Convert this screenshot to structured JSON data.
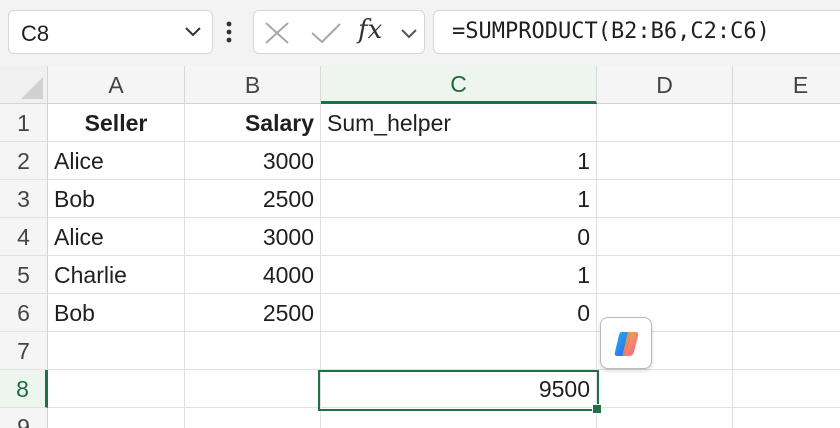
{
  "name_box": {
    "value": "C8"
  },
  "formula_bar": {
    "fx_label": "fx",
    "formula": "=SUMPRODUCT(B2:B6,C2:C6)"
  },
  "columns": [
    "A",
    "B",
    "C",
    "D",
    "E"
  ],
  "rows": [
    "1",
    "2",
    "3",
    "4",
    "5",
    "6",
    "7",
    "8",
    "9"
  ],
  "cells": {
    "A1": "Seller",
    "B1": "Salary",
    "C1": "Sum_helper",
    "A2": "Alice",
    "B2": "3000",
    "C2": "1",
    "A3": "Bob",
    "B3": "2500",
    "C3": "1",
    "A4": "Alice",
    "B4": "3000",
    "C4": "0",
    "A5": "Charlie",
    "B5": "4000",
    "C5": "1",
    "A6": "Bob",
    "B6": "2500",
    "C6": "0",
    "C8": "9500"
  },
  "selection": {
    "active_cell": "C8",
    "active_column": "C",
    "active_row": "8"
  },
  "colors": {
    "accent": "#1e7145"
  }
}
